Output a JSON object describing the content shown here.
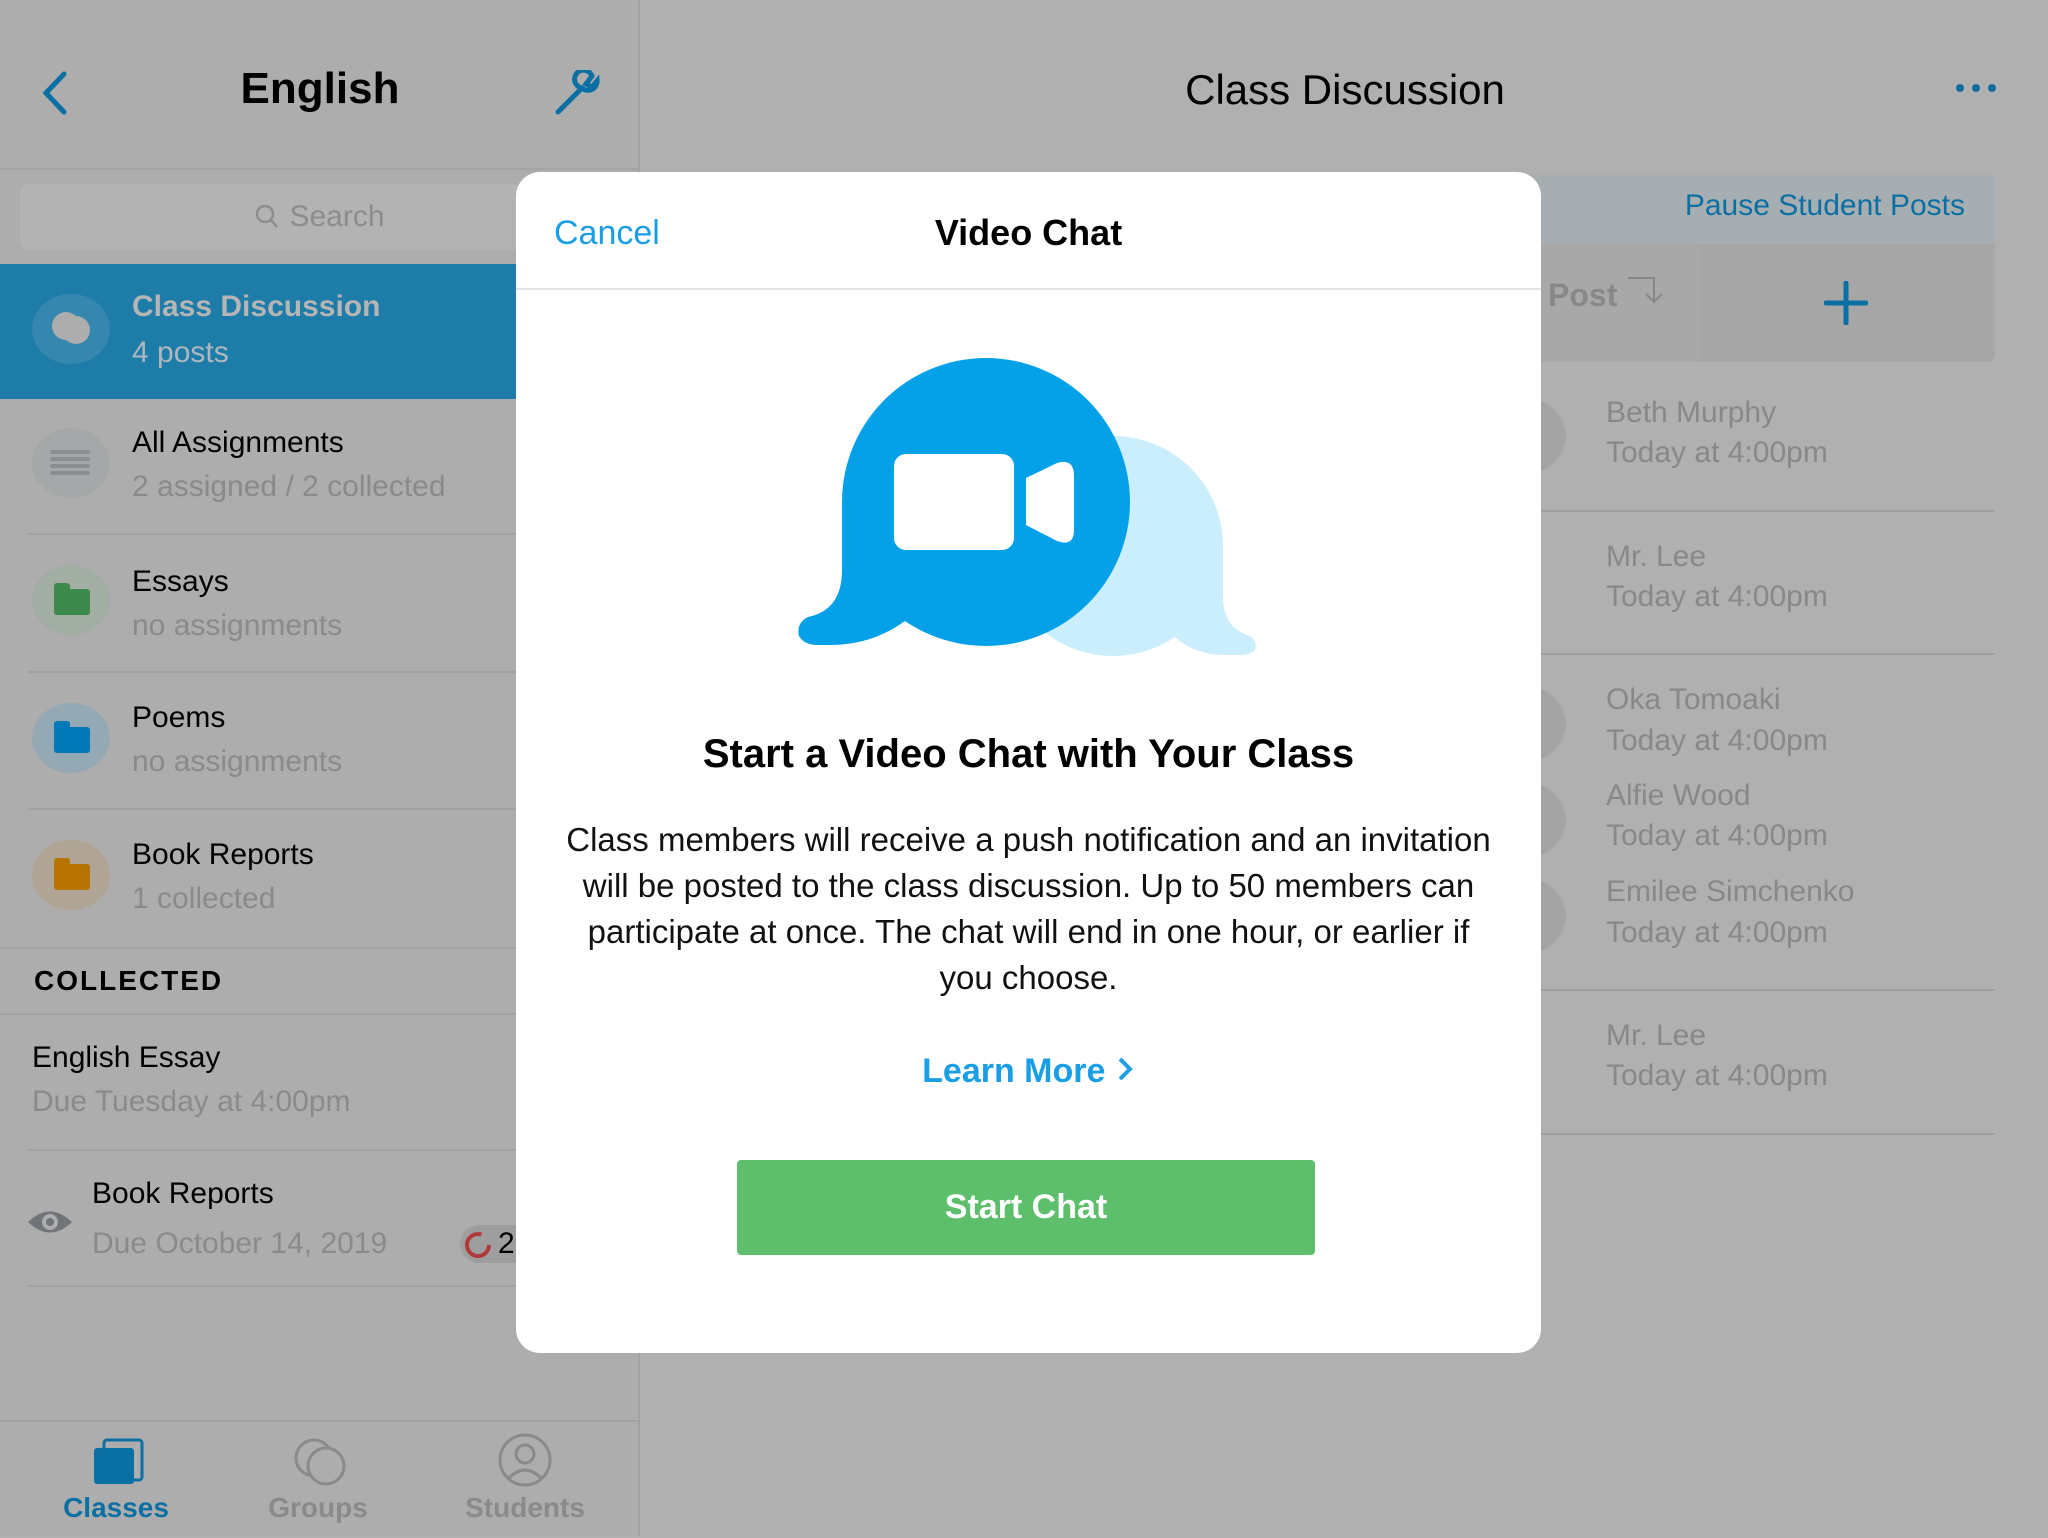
{
  "sidebar": {
    "title": "English",
    "search_placeholder": "Search",
    "items": [
      {
        "label": "Class Discussion",
        "sub": "4 posts",
        "selected": true,
        "icon": "chat-bubbles-icon"
      },
      {
        "label": "All Assignments",
        "sub": "2 assigned / 2 collected",
        "icon": "list-icon"
      },
      {
        "label": "Essays",
        "sub": "no assignments",
        "icon": "folder-icon",
        "color": "#3e8a4c"
      },
      {
        "label": "Poems",
        "sub": "no assignments",
        "icon": "folder-icon",
        "color": "#0079b8"
      },
      {
        "label": "Book Reports",
        "sub": "1 collected",
        "icon": "folder-icon",
        "color": "#b77400"
      }
    ],
    "section_header": "COLLECTED",
    "collected": [
      {
        "label": "English Essay",
        "sub": "Due Tuesday at 4:00pm"
      },
      {
        "label": "Book Reports",
        "sub": "Due October 14, 2019",
        "badge": "2",
        "icon": "eye-icon"
      }
    ],
    "tabs": [
      {
        "label": "Classes",
        "active": true
      },
      {
        "label": "Groups"
      },
      {
        "label": "Students"
      }
    ]
  },
  "main": {
    "title": "Class Discussion",
    "pause_label": "Pause Student Posts",
    "sort_label": "Post",
    "posts": [
      {
        "name": "Beth Murphy",
        "time": "Today at 4:00pm"
      },
      {
        "name": "Mr. Lee",
        "time": "Today at 4:00pm"
      },
      {
        "name": "Oka Tomoaki",
        "time": "Today at 4:00pm"
      },
      {
        "name": "Alfie Wood",
        "time": "Today at 4:00pm"
      },
      {
        "name": "Emilee Simchenko",
        "time": "Today at 4:00pm"
      },
      {
        "name": "Mr. Lee",
        "time": "Today at 4:00pm"
      }
    ]
  },
  "modal": {
    "cancel": "Cancel",
    "title": "Video Chat",
    "heading": "Start a Video Chat with Your Class",
    "body": "Class members will receive a push notification and an invitation will be posted to the class discussion. Up to 50 members can participate at once. The chat will end in one hour, or earlier if you choose.",
    "learn_more": "Learn More",
    "start": "Start Chat"
  },
  "colors": {
    "accent": "#1a9ee6",
    "primary_button": "#5dbf6c",
    "selected_row": "#1e7ca8",
    "illustration_dark": "#05a1e8",
    "illustration_light": "#cbeefd"
  }
}
